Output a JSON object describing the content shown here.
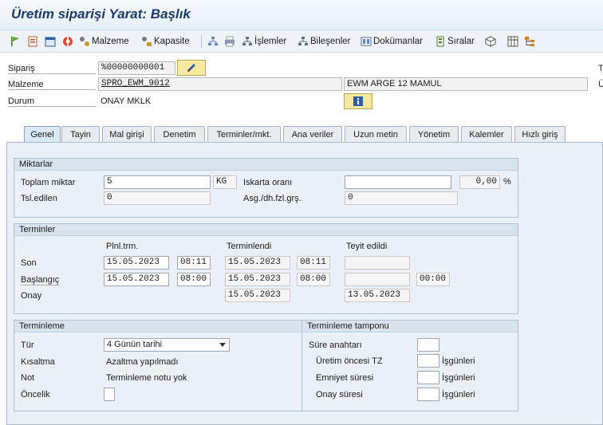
{
  "title": "Üretim siparişi Yarat: Başlık",
  "toolbar": {
    "material": "Malzeme",
    "capacity": "Kapasite",
    "operations": "İşlemler",
    "components": "Bileşenler",
    "documents": "Dokümanlar",
    "sequences": "Sıralar"
  },
  "header": {
    "order_label": "Sipariş",
    "order_value": "%00000000001",
    "material_label": "Malzeme",
    "material_value": "SPRO_EWM_9012",
    "material_desc": "EWM ARGE 12 MAMUL",
    "status_label": "Durum",
    "status_value": "ONAY MKLK",
    "right_t": "T",
    "right_u": "Ü"
  },
  "tabs": [
    "Genel",
    "Tayin",
    "Mal girişi",
    "Denetim",
    "Terminler/mkt.",
    "Ana veriler",
    "Uzun metin",
    "Yönetim",
    "Kalemler",
    "Hızlı giriş"
  ],
  "quantities": {
    "title": "Miktarlar",
    "total_label": "Toplam miktar",
    "total_value": "5",
    "unit": "KG",
    "scrap_label": "Iskarta oranı",
    "scrap_value": "",
    "scrap_pct": "0,00",
    "pct_sign": "%",
    "delivered_label": "Tsl.edilen",
    "delivered_value": "0",
    "over_label": "Asg./dh.fzl.grş.",
    "over_value": "0"
  },
  "dates": {
    "title": "Terminler",
    "col_planned": "Plnl.trm.",
    "col_scheduled": "Terminlendi",
    "col_confirmed": "Teyit edildi",
    "finish_label": "Son",
    "start_label": "Başlangıç",
    "release_label": "Onay",
    "finish_planned_date": "15.05.2023",
    "finish_planned_time": "08:11",
    "finish_sched_date": "15.05.2023",
    "finish_sched_time": "08:11",
    "start_planned_date": "15.05.2023",
    "start_planned_time": "08:00",
    "start_sched_date": "15.05.2023",
    "start_sched_time": "08:00",
    "start_conf_time": "00:00",
    "release_sched_date": "15.05.2023",
    "release_conf_date": "13.05.2023"
  },
  "scheduling": {
    "title": "Terminleme",
    "type_label": "Tür",
    "type_value": "4 Günün tarihi",
    "reduction_label": "Kısaltma",
    "reduction_value": "Azaltma yapılmadı",
    "note_label": "Not",
    "note_value": "Terminleme notu yok",
    "priority_label": "Öncelik"
  },
  "buffer": {
    "title": "Terminleme tamponu",
    "key_label": "Süre anahtarı",
    "pre_label": "Üretim öncesi TZ",
    "safety_label": "Emniyet süresi",
    "release_label": "Onay süresi",
    "unit": "İşgünleri"
  }
}
